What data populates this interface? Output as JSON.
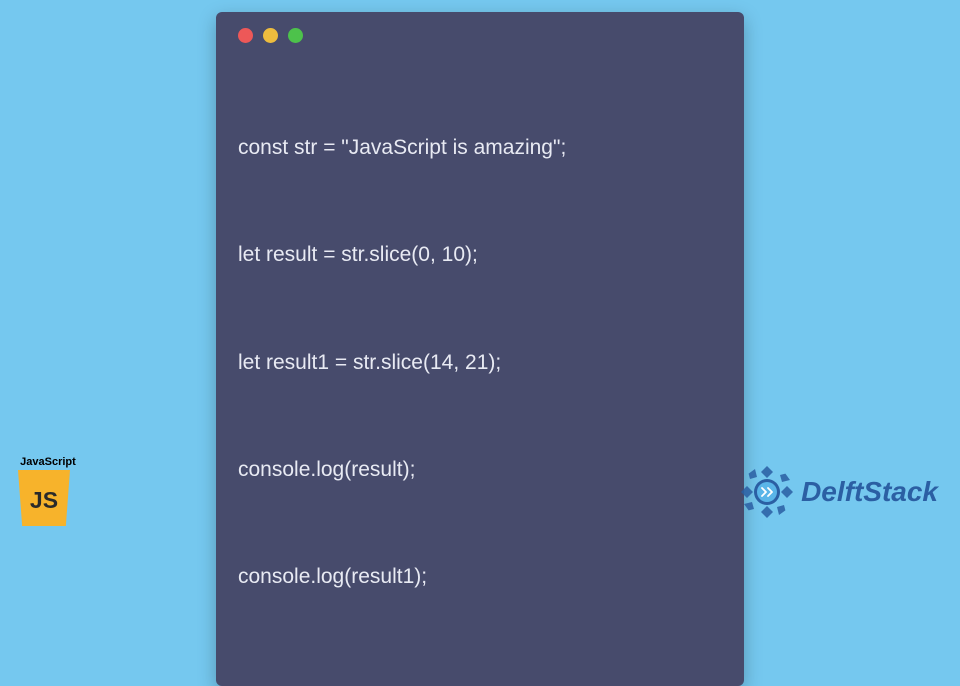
{
  "code": {
    "lines": [
      "const str = \"JavaScript is amazing\";",
      "let result = str.slice(0, 10);",
      "let result1 = str.slice(14, 21);",
      "console.log(result);",
      "console.log(result1);"
    ]
  },
  "badges": {
    "js_label": "JavaScript",
    "js_short": "JS",
    "delft_text": "DelftStack"
  },
  "colors": {
    "background": "#75c8ef",
    "window": "#474b6c",
    "code_text": "#e8eaf3",
    "js_icon_bg": "#f7b32b",
    "delft_color": "#2b5fa3",
    "dot_red": "#ed5858",
    "dot_yellow": "#edbc3e",
    "dot_green": "#4dc24b"
  }
}
